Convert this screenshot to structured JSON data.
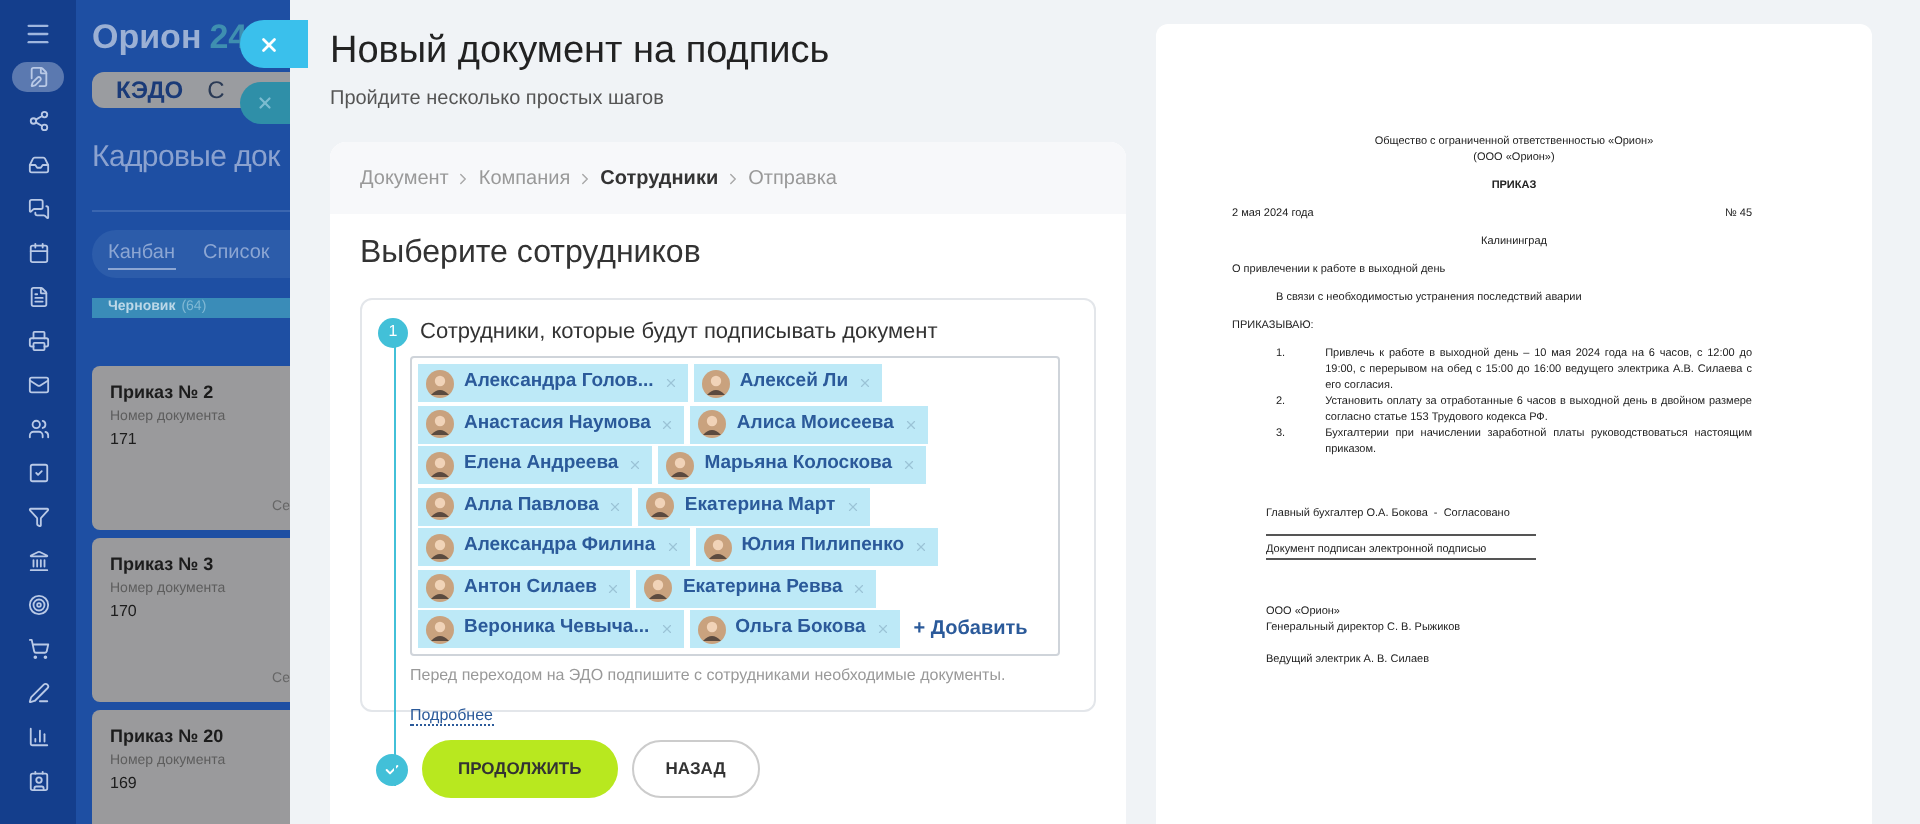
{
  "background_app": {
    "logo": "Орион",
    "logo_number": "24",
    "sidebar_icons": [
      {
        "selected": true
      },
      {
        "selected": false
      },
      {
        "selected": false
      },
      {
        "selected": false
      },
      {
        "selected": false
      },
      {
        "selected": false
      },
      {
        "selected": false
      },
      {
        "selected": false
      },
      {
        "selected": false
      },
      {
        "selected": false
      },
      {
        "selected": false
      },
      {
        "selected": false
      },
      {
        "selected": false
      },
      {
        "selected": false
      },
      {
        "selected": false
      },
      {
        "selected": false
      },
      {
        "selected": false
      }
    ],
    "tabs": [
      {
        "label": "КЭДО",
        "selected": true
      },
      {
        "label": "С",
        "selected": false
      }
    ],
    "page_title": "Кадровые док",
    "views": [
      {
        "label": "Канбан",
        "selected": true
      },
      {
        "label": "Список",
        "selected": false
      }
    ],
    "column": {
      "title": "Черновик",
      "count": "(64)"
    },
    "cards": [
      {
        "title": "Приказ № 2",
        "label": "Номер документа",
        "number": "171",
        "footer": "Се"
      },
      {
        "title": "Приказ № 3",
        "label": "Номер документа",
        "number": "170",
        "footer": "Се"
      },
      {
        "title": "Приказ № 20",
        "label": "Номер документа",
        "number": "169"
      }
    ]
  },
  "panel": {
    "title": "Новый документ на подпись",
    "subtitle": "Пройдите несколько простых шагов",
    "breadcrumbs": [
      {
        "label": "Документ",
        "selected": false
      },
      {
        "label": "Компания",
        "selected": false
      },
      {
        "label": "Сотрудники",
        "selected": true
      },
      {
        "label": "Отправка",
        "selected": false
      }
    ],
    "heading": "Выберите сотрудников",
    "step": {
      "number": "1",
      "label": "Сотрудники, которые будут подписывать документ"
    },
    "employees": [
      {
        "name": "Александра Голов..."
      },
      {
        "name": "Алексей Ли"
      },
      {
        "name": "Анастасия Наумова"
      },
      {
        "name": "Алиса Моисеева"
      },
      {
        "name": "Елена Андреева"
      },
      {
        "name": "Марьяна Колоскова"
      },
      {
        "name": "Алла Павлова"
      },
      {
        "name": "Екатерина Март"
      },
      {
        "name": "Александра Филина"
      },
      {
        "name": "Юлия Пилипенко"
      },
      {
        "name": "Антон Силаев"
      },
      {
        "name": "Екатерина Ревва"
      },
      {
        "name": "Вероника Чевыча..."
      },
      {
        "name": "Ольга Бокова"
      }
    ],
    "add_link": "+ Добавить",
    "hint": "Перед переходом на ЭДО подпишите с сотрудниками необходимые документы.",
    "hint_link": "Подробнее",
    "buttons": [
      {
        "label": "ПРОДОЛЖИТЬ",
        "kind": "primary"
      },
      {
        "label": "НАЗАД",
        "kind": "secondary"
      }
    ]
  },
  "document": {
    "org": "Общество с ограниченной ответственностью «Орион»",
    "org_short": "(ООО «Орион»)",
    "type": "ПРИКАЗ",
    "date": "2 мая 2024 года",
    "number": "№ 45",
    "city": "Калининград",
    "subject": "О привлечении к работе в выходной день",
    "reason": "В связи с необходимостью устранения последствий аварии",
    "order_word": "ПРИКАЗЫВАЮ:",
    "items": [
      {
        "n": "1.",
        "text": "Привлечь к работе в выходной день – 10 мая 2024 года на 6 часов, с 12:00 до 19:00, с перерывом на обед с 15:00 до 16:00 ведущего электрика А.В. Силаева с его согласия."
      },
      {
        "n": "2.",
        "text": "Установить оплату за отработанные 6 часов в выходной день в двойном размере согласно статье 153 Трудового кодекса РФ."
      },
      {
        "n": "3.",
        "text": "Бухгалтерии при начислении заработной платы руководствоваться настоящим приказом."
      }
    ],
    "approval": "Главный бухгалтер О.А. Бокова  -  Согласовано",
    "signed": "Документ подписан электронной подписью",
    "signatures": [
      "ООО «Орион»",
      "Генеральный директор С. В. Рыжиков"
    ],
    "employee_sign": "Ведущий электрик А. В. Силаев"
  }
}
